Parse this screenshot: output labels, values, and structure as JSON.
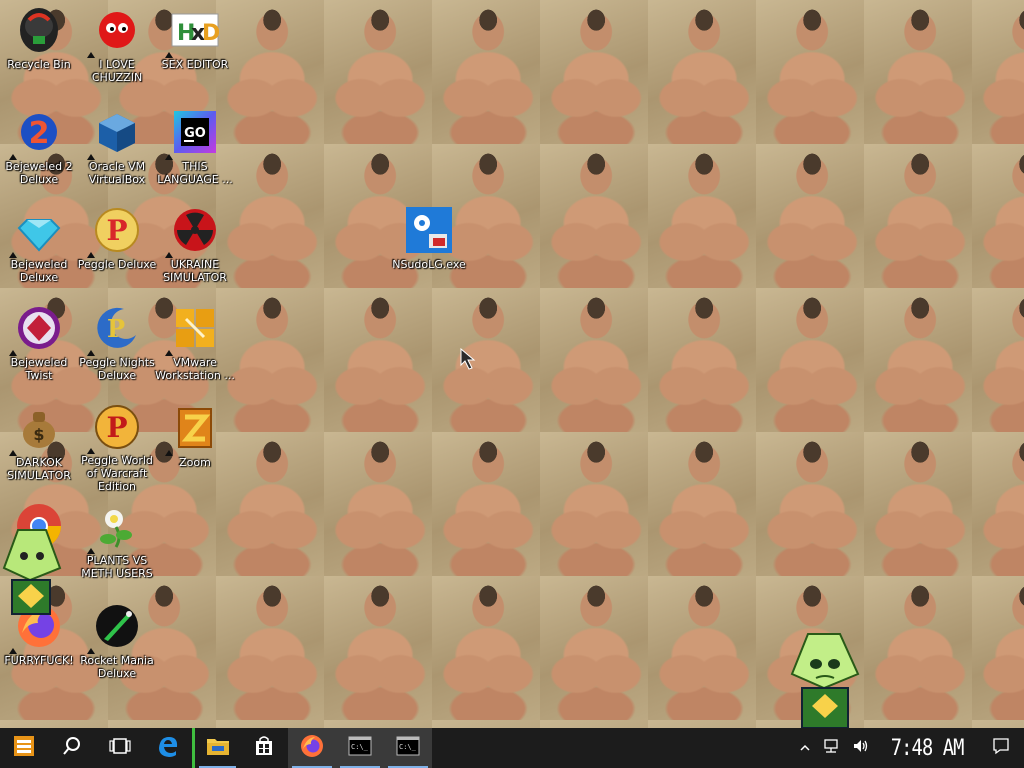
{
  "desktop": {
    "icons": [
      {
        "label": "Recycle Bin",
        "icon": "recycle-bin-icon"
      },
      {
        "label": "I LOVE CHUZZIN",
        "icon": "chuzzle-icon"
      },
      {
        "label": "SEX EDITOR",
        "icon": "hxd-hex-editor-icon"
      },
      {
        "label": "Bejeweled 2 Deluxe",
        "icon": "bejeweled-2-icon"
      },
      {
        "label": "Oracle VM VirtualBox",
        "icon": "virtualbox-icon"
      },
      {
        "label": "THIS LANGUAGE ...",
        "icon": "goland-icon"
      },
      {
        "label": "Bejeweled Deluxe",
        "icon": "bejeweled-gem-icon"
      },
      {
        "label": "Peggle Deluxe",
        "icon": "peggle-icon"
      },
      {
        "label": "UKRAINE SIMULATOR",
        "icon": "radiation-icon"
      },
      {
        "label": "NSudoLG.exe",
        "icon": "nsudo-icon"
      },
      {
        "label": "Bejeweled Twist",
        "icon": "bejeweled-twist-icon"
      },
      {
        "label": "Peggle Nights Deluxe",
        "icon": "peggle-nights-icon"
      },
      {
        "label": "VMware Workstation ...",
        "icon": "vmware-icon"
      },
      {
        "label": "DARKOK SIMULATOR",
        "icon": "money-bag-icon"
      },
      {
        "label": "Peggle World of Warcraft Edition",
        "icon": "peggle-wow-icon"
      },
      {
        "label": "Zoom",
        "icon": "zoom-icon"
      },
      {
        "label": "",
        "icon": "chrome-icon"
      },
      {
        "label": "PLANTS VS METH USERS",
        "icon": "plants-icon"
      },
      {
        "label": "FURRYFUCK!",
        "icon": "firefox-icon"
      },
      {
        "label": "Rocket Mania Deluxe",
        "icon": "rocket-mania-icon"
      }
    ]
  },
  "taskbar": {
    "buttons": [
      {
        "name": "start-button",
        "icon": "start-icon"
      },
      {
        "name": "search-button",
        "icon": "search-icon"
      },
      {
        "name": "task-view-button",
        "icon": "task-view-icon"
      },
      {
        "name": "edge-button",
        "icon": "edge-icon"
      },
      {
        "name": "file-explorer-button",
        "icon": "folder-icon"
      },
      {
        "name": "store-button",
        "icon": "store-icon"
      },
      {
        "name": "firefox-button",
        "icon": "firefox-icon"
      },
      {
        "name": "cmd-button-1",
        "icon": "terminal-icon"
      },
      {
        "name": "cmd-button-2",
        "icon": "terminal-icon"
      }
    ],
    "tray": {
      "clock": "7:48 AM"
    }
  },
  "colors": {
    "taskbar_bg": "#1c1c1c",
    "running_indicator": "#7fb1e8"
  }
}
